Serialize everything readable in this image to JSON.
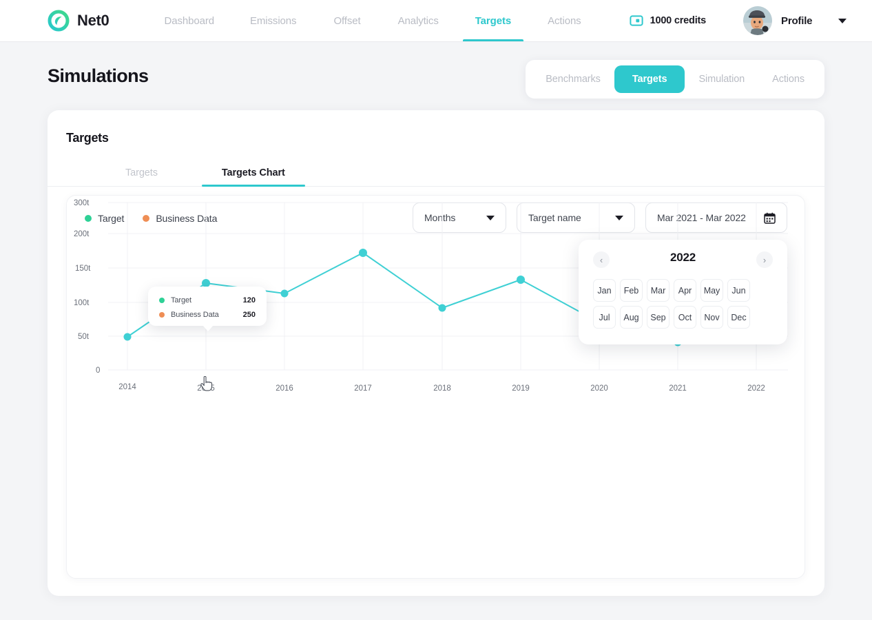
{
  "brand": {
    "name": "Net0",
    "logo_icon": "net0-leaf-circle-logo"
  },
  "topnav": {
    "links": [
      {
        "label": "Dashboard",
        "active": false
      },
      {
        "label": "Emissions",
        "active": false
      },
      {
        "label": "Offset",
        "active": false
      },
      {
        "label": "Analytics",
        "active": false
      },
      {
        "label": "Targets",
        "active": true
      },
      {
        "label": "Actions",
        "active": false
      }
    ],
    "credits": {
      "label": "1000 credits",
      "icon": "credits-card-icon"
    },
    "profile": {
      "label": "Profile",
      "avatar_icon": "user-avatar",
      "caret_icon": "chevron-down-icon"
    }
  },
  "pagehead": {
    "title": "Simulations",
    "segments": [
      {
        "label": "Benchmarks",
        "active": false
      },
      {
        "label": "Targets",
        "active": true
      },
      {
        "label": "Simulation",
        "active": false
      },
      {
        "label": "Actions",
        "active": false
      }
    ]
  },
  "card": {
    "title": "Targets",
    "tabs": [
      {
        "label": "Targets",
        "active": false
      },
      {
        "label": "Targets Chart",
        "active": true
      }
    ]
  },
  "filters": {
    "months": {
      "value": "Months",
      "caret_icon": "chevron-down-icon"
    },
    "target_name": {
      "value": "Target name",
      "caret_icon": "chevron-down-icon"
    },
    "date_range": {
      "value": "Mar 2021 - Mar 2022",
      "icon": "calendar-icon"
    }
  },
  "datepicker": {
    "year": "2022",
    "prev_icon": "chevron-left-icon",
    "next_icon": "chevron-right-icon",
    "months": [
      "Jan",
      "Feb",
      "Mar",
      "Apr",
      "May",
      "Jun",
      "Jul",
      "Aug",
      "Sep",
      "Oct",
      "Nov",
      "Dec"
    ]
  },
  "tooltip": {
    "rows": [
      {
        "name": "Target",
        "value": "120",
        "color": "#2ed196"
      },
      {
        "name": "Business Data",
        "value": "250",
        "color": "#ef8e55"
      }
    ]
  },
  "colors": {
    "accent": "#2ec8cd",
    "target": "#2ed196",
    "business_data": "#ef8e55",
    "line": "#3fd0d4",
    "page_bg": "#f4f5f7",
    "muted_text": "#b9bcc4"
  },
  "chart_data": {
    "type": "line",
    "title": "",
    "xlabel": "",
    "ylabel": "",
    "grid": true,
    "legend_position": "top-left",
    "legend": [
      {
        "name": "Target",
        "color": "#2ed196"
      },
      {
        "name": "Business Data",
        "color": "#ef8e55"
      }
    ],
    "categories": [
      "2014",
      "2015",
      "2016",
      "2017",
      "2018",
      "2019",
      "2020",
      "2021",
      "2022"
    ],
    "ytick_labels": [
      "300t",
      "200t",
      "150t",
      "100t",
      "50t",
      "0"
    ],
    "ytick_values": [
      300,
      200,
      150,
      100,
      50,
      0
    ],
    "ylim": [
      0,
      300
    ],
    "series": [
      {
        "name": "Target",
        "color": "#3fd0d4",
        "values": [
          50,
          128,
          113,
          173,
          92,
          132,
          70,
          40,
          66
        ]
      }
    ]
  }
}
